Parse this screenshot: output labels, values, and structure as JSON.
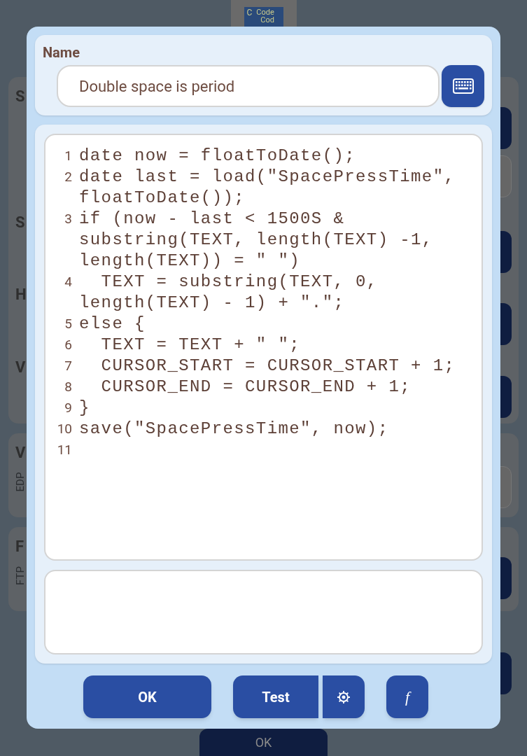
{
  "background": {
    "logo": {
      "texts": [
        "C",
        "Code",
        "Cod"
      ]
    },
    "cards": [
      {
        "labels": [
          "S",
          "S",
          "H",
          "V"
        ]
      },
      {
        "labels": [
          "V"
        ],
        "sublabel": "EDP"
      },
      {
        "labels": [
          "F"
        ],
        "sublabel": "FTP"
      }
    ],
    "ok_button": "OK"
  },
  "dialog": {
    "name_label": "Name",
    "name_value": "Double space is period",
    "code_lines": [
      {
        "number": "1",
        "code": "date now = floatToDate();"
      },
      {
        "number": "2",
        "code": "date last = load(\"SpacePressTime\", floatToDate());"
      },
      {
        "number": "3",
        "code": "if (now - last < 1500S & substring(TEXT, length(TEXT) -1, length(TEXT)) = \" \")"
      },
      {
        "number": "4",
        "code": "  TEXT = substring(TEXT, 0, length(TEXT) - 1) + \".\";"
      },
      {
        "number": "5",
        "code": "else {"
      },
      {
        "number": "6",
        "code": "  TEXT = TEXT + \" \";"
      },
      {
        "number": "7",
        "code": "  CURSOR_START = CURSOR_START + 1;"
      },
      {
        "number": "8",
        "code": "  CURSOR_END = CURSOR_END + 1;"
      },
      {
        "number": "9",
        "code": "}"
      },
      {
        "number": "10",
        "code": "save(\"SpacePressTime\", now);"
      },
      {
        "number": "11"
      }
    ],
    "buttons": {
      "ok": "OK",
      "test": "Test",
      "function": "f"
    }
  }
}
